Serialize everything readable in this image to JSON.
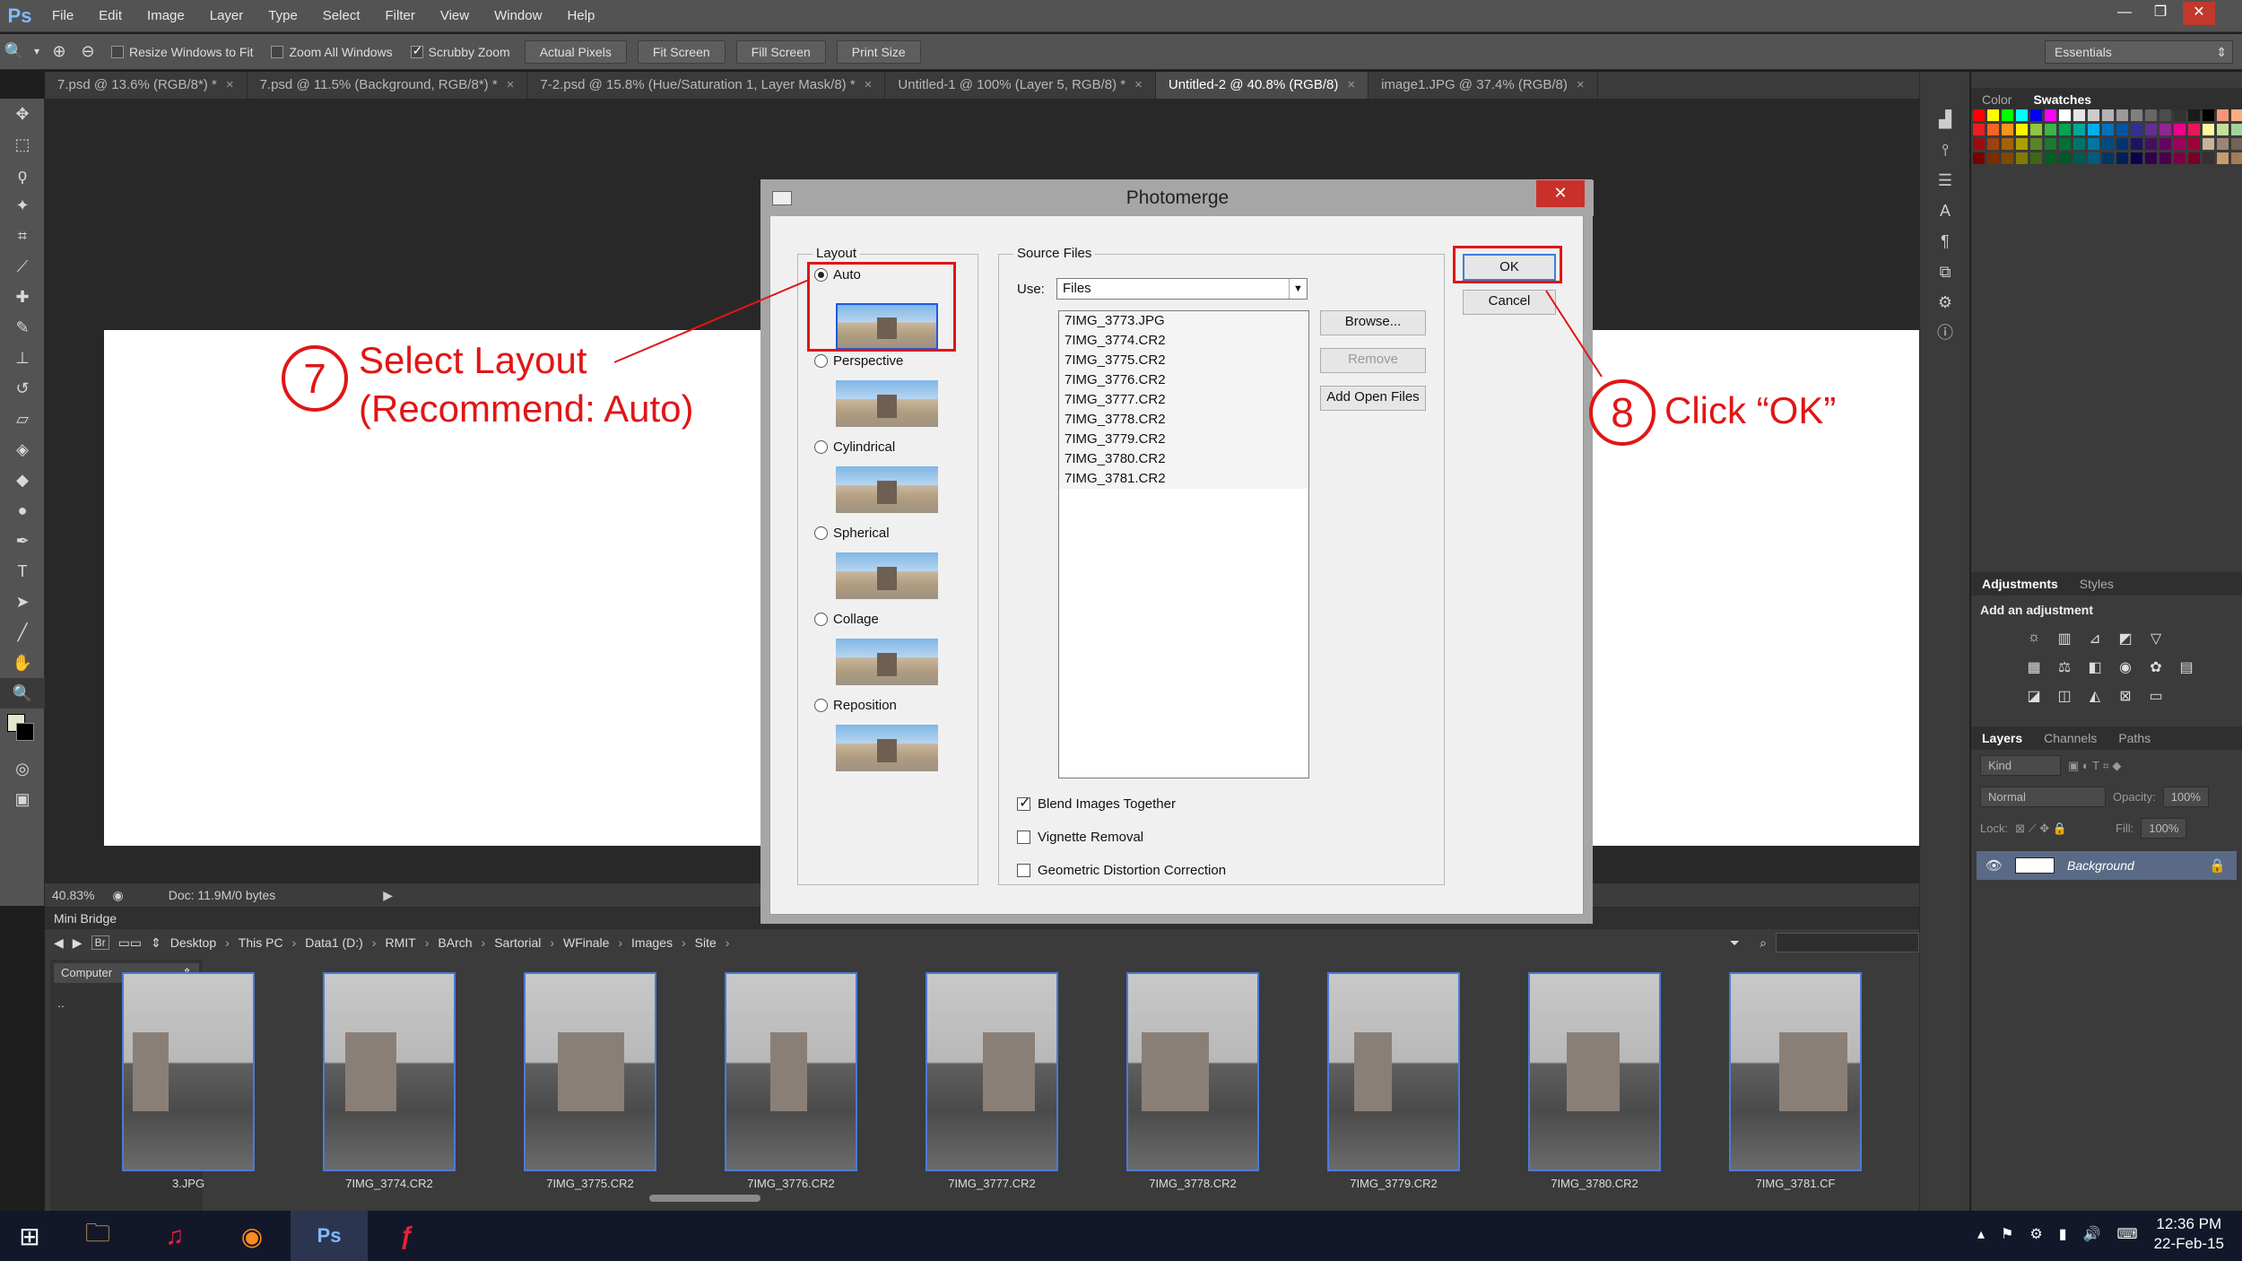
{
  "app": {
    "logo": "Ps",
    "menu": [
      "File",
      "Edit",
      "Image",
      "Layer",
      "Type",
      "Select",
      "Filter",
      "View",
      "Window",
      "Help"
    ]
  },
  "window_controls": {
    "minimize": "—",
    "restore": "❐",
    "close": "✕"
  },
  "options": {
    "resize_windows": "Resize Windows to Fit",
    "zoom_all": "Zoom All Windows",
    "scrubby_zoom": "Scrubby Zoom",
    "buttons": [
      "Actual Pixels",
      "Fit Screen",
      "Fill Screen",
      "Print Size"
    ],
    "workspace": "Essentials"
  },
  "tabs": [
    {
      "label": "7.psd @ 13.6% (RGB/8*) *",
      "active": false
    },
    {
      "label": "7.psd @ 11.5% (Background, RGB/8*) *",
      "active": false
    },
    {
      "label": "7-2.psd @ 15.8% (Hue/Saturation 1, Layer Mask/8) *",
      "active": false
    },
    {
      "label": "Untitled-1 @ 100% (Layer 5, RGB/8) *",
      "active": false
    },
    {
      "label": "Untitled-2 @ 40.8% (RGB/8)",
      "active": true
    },
    {
      "label": "image1.JPG @ 37.4% (RGB/8)",
      "active": false
    }
  ],
  "status": {
    "zoom": "40.83%",
    "doc": "Doc: 11.9M/0 bytes"
  },
  "right_panel": {
    "color_tabs": [
      "Color",
      "Swatches"
    ],
    "adjust_tabs": [
      "Adjustments",
      "Styles"
    ],
    "adjust_title": "Add an adjustment",
    "layers_tabs": [
      "Layers",
      "Channels",
      "Paths"
    ],
    "kind": "Kind",
    "blend_mode": "Normal",
    "opacity_label": "Opacity:",
    "opacity": "100%",
    "lock_label": "Lock:",
    "fill_label": "Fill:",
    "fill": "100%",
    "layer_name": "Background"
  },
  "swatch_colors": [
    "#ff0000",
    "#ffff00",
    "#00ff00",
    "#00ffff",
    "#0000ff",
    "#ff00ff",
    "#ffffff",
    "#e6e6e6",
    "#cccccc",
    "#b3b3b3",
    "#999999",
    "#808080",
    "#666666",
    "#4d4d4d",
    "#333333",
    "#1a1a1a",
    "#000000",
    "#f7977a",
    "#fbad82",
    "#fdc68c",
    "#ed1c24",
    "#f26522",
    "#f7941d",
    "#fff200",
    "#8dc63f",
    "#39b54a",
    "#00a651",
    "#00a99d",
    "#00aeef",
    "#0072bc",
    "#0054a6",
    "#2e3192",
    "#662d91",
    "#92278f",
    "#ec008c",
    "#ed145b",
    "#fff799",
    "#c4df9b",
    "#a3d39c",
    "#82ca9c",
    "#9e0b0f",
    "#a0410d",
    "#a36209",
    "#aba000",
    "#598527",
    "#1a7b30",
    "#007236",
    "#00746b",
    "#0076a3",
    "#004b80",
    "#003471",
    "#1b1464",
    "#440e62",
    "#630460",
    "#9e005d",
    "#9e0039",
    "#c7b299",
    "#998675",
    "#736357",
    "#534741",
    "#790000",
    "#7b2e00",
    "#7d4900",
    "#827b00",
    "#406618",
    "#005e20",
    "#005826",
    "#005952",
    "#005b7f",
    "#003663",
    "#002157",
    "#0d004c",
    "#32004b",
    "#4b0049",
    "#7b0046",
    "#7a0026",
    "#37302e",
    "#c69c6d",
    "#a67c52",
    "#8c6239"
  ],
  "dialog": {
    "title": "Photomerge",
    "close": "✕",
    "layout_legend": "Layout",
    "layouts": [
      "Auto",
      "Perspective",
      "Cylindrical",
      "Spherical",
      "Collage",
      "Reposition"
    ],
    "selected_layout": "Auto",
    "source_legend": "Source Files",
    "use_label": "Use:",
    "use_value": "Files",
    "files": [
      "7IMG_3773.JPG",
      "7IMG_3774.CR2",
      "7IMG_3775.CR2",
      "7IMG_3776.CR2",
      "7IMG_3777.CR2",
      "7IMG_3778.CR2",
      "7IMG_3779.CR2",
      "7IMG_3780.CR2",
      "7IMG_3781.CR2"
    ],
    "browse": "Browse...",
    "remove": "Remove",
    "add_open": "Add Open Files",
    "blend": "Blend Images Together",
    "blend_checked": true,
    "vignette": "Vignette Removal",
    "vignette_checked": false,
    "geometric": "Geometric Distortion Correction",
    "geometric_checked": false,
    "ok": "OK",
    "cancel": "Cancel"
  },
  "annotations": {
    "step7_num": "7",
    "step7_line1": "Select Layout",
    "step7_line2": "(Recommend: Auto)",
    "step8_num": "8",
    "step8_text": "Click “OK”",
    "color": "#e01616"
  },
  "mini_bridge": {
    "title": "Mini Bridge",
    "path": [
      "Desktop",
      "This PC",
      "Data1 (D:)",
      "RMIT",
      "BArch",
      "Sartorial",
      "WFinale",
      "Images",
      "Site"
    ],
    "source": "Computer",
    "parent": "..",
    "thumbs": [
      "3.JPG",
      "7IMG_3774.CR2",
      "7IMG_3775.CR2",
      "7IMG_3776.CR2",
      "7IMG_3777.CR2",
      "7IMG_3778.CR2",
      "7IMG_3779.CR2",
      "7IMG_3780.CR2",
      "7IMG_3781.CF"
    ]
  },
  "taskbar": {
    "time": "12:36 PM",
    "date": "22-Feb-15"
  }
}
